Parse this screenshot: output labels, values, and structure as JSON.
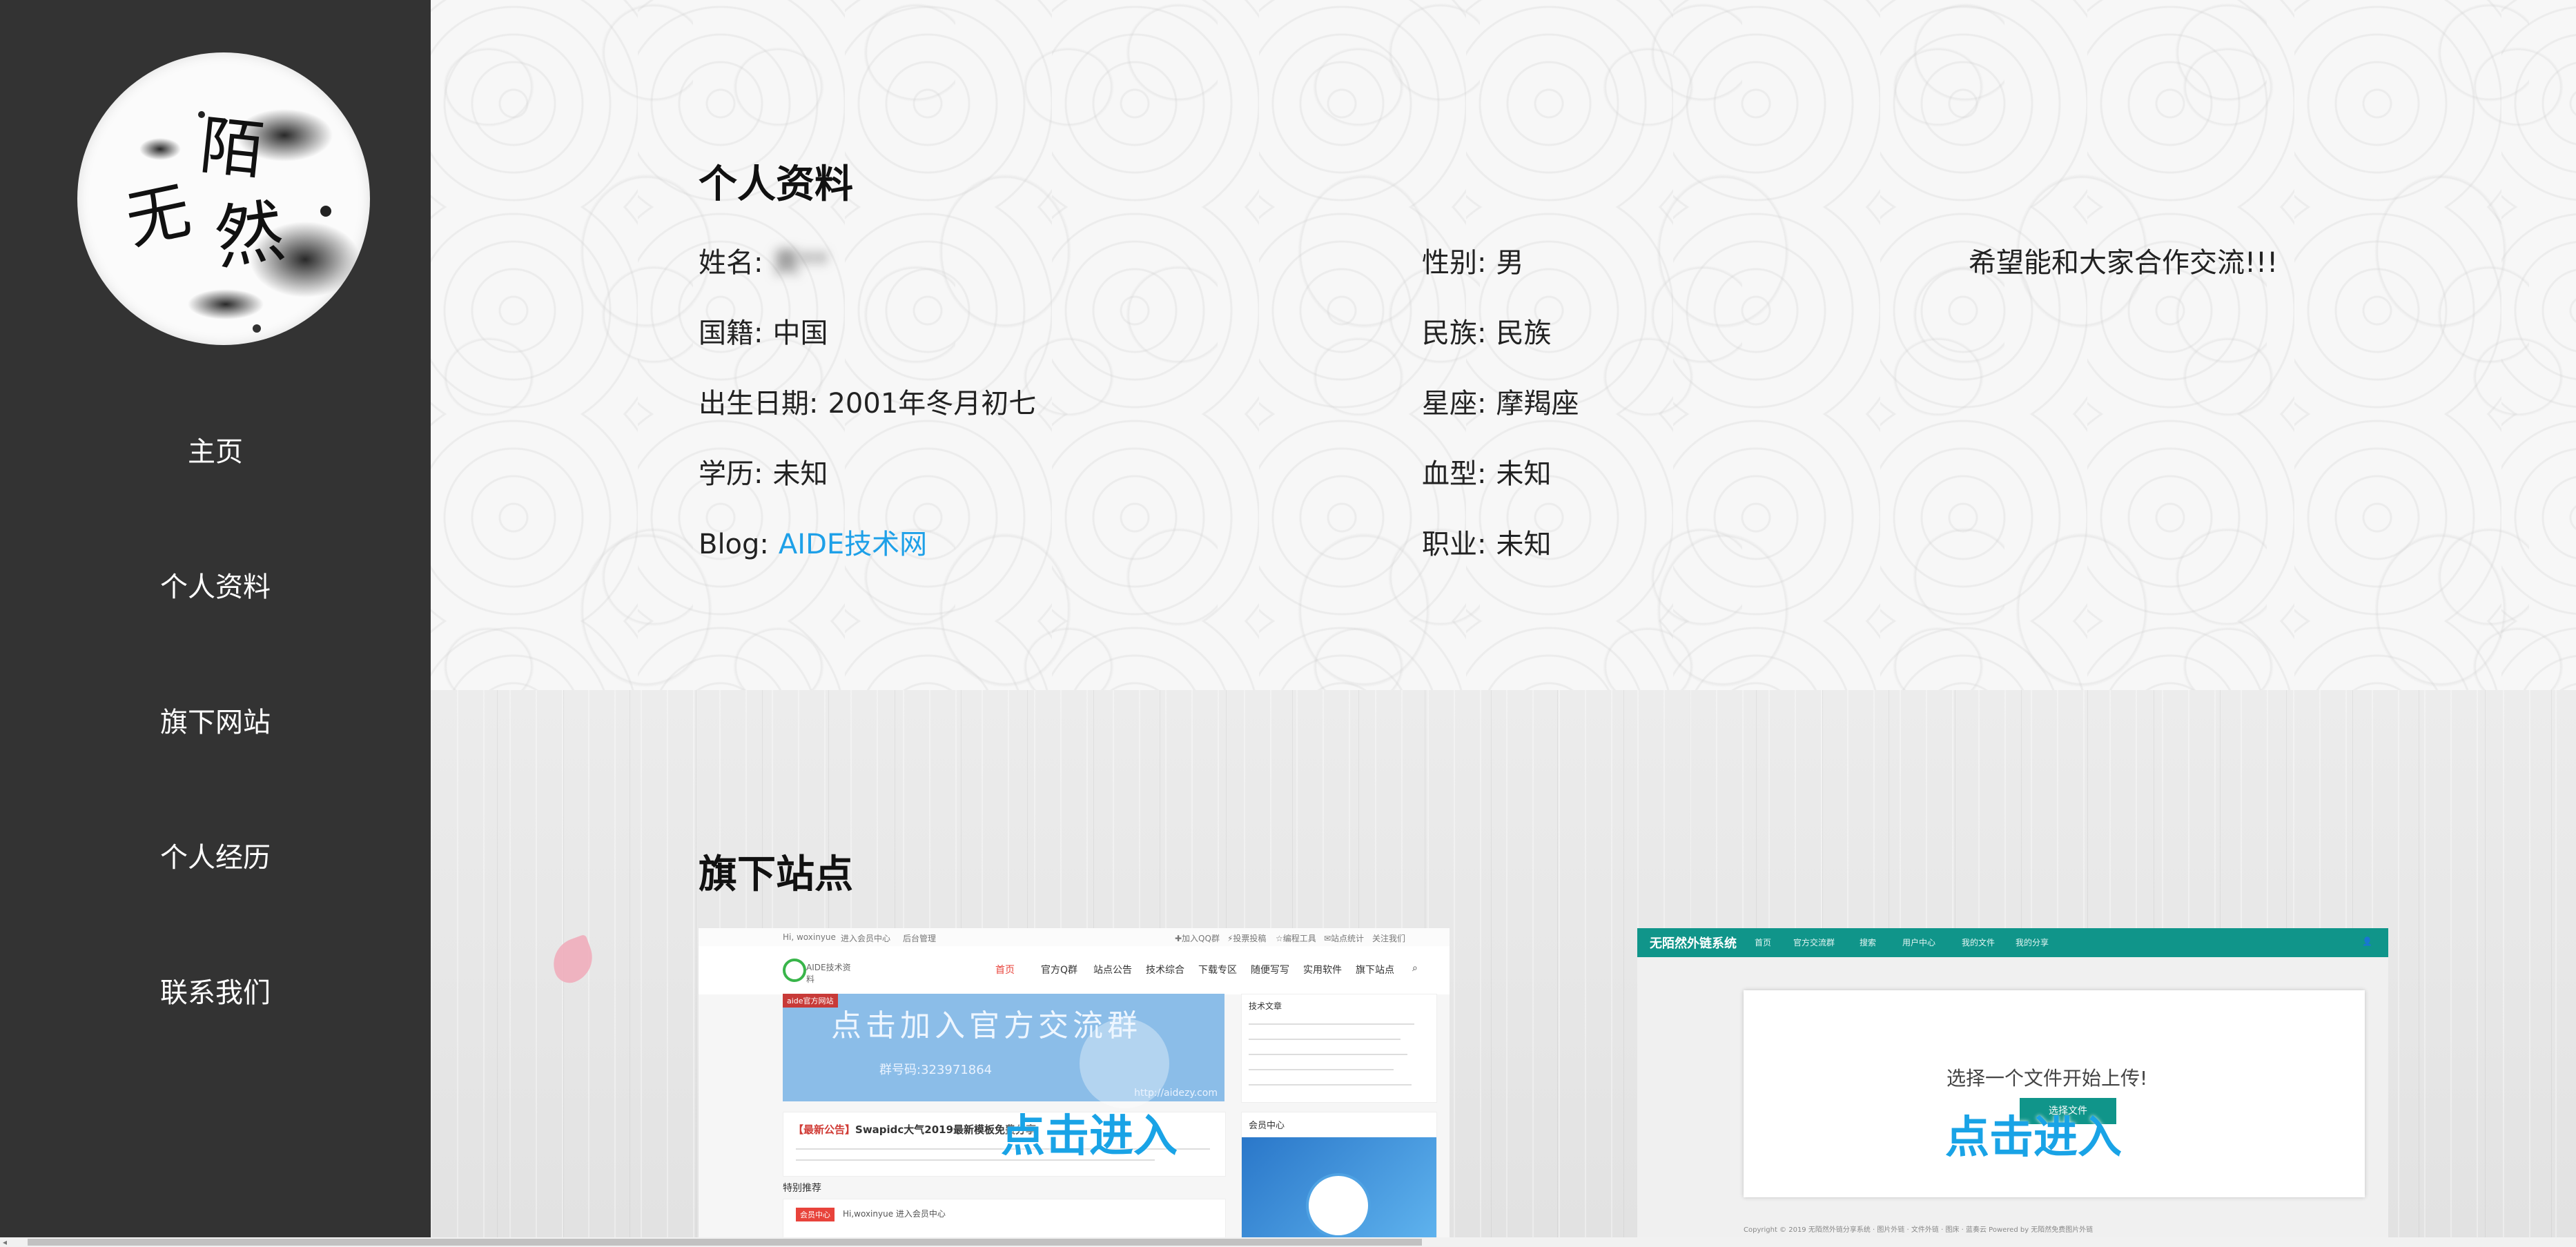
{
  "sidebar": {
    "nav": [
      {
        "label": "主页"
      },
      {
        "label": "个人资料"
      },
      {
        "label": "旗下网站"
      },
      {
        "label": "个人经历"
      },
      {
        "label": "联系我们"
      }
    ],
    "logo_text": "无陌然"
  },
  "profile": {
    "title": "个人资料",
    "fields": {
      "name": {
        "label": "姓名:",
        "value": "黄**"
      },
      "gender": {
        "label": "性别:",
        "value": "男"
      },
      "nationality": {
        "label": "国籍:",
        "value": "中国"
      },
      "ethnicity": {
        "label": "民族:",
        "value": "民族"
      },
      "birthday": {
        "label": "出生日期:",
        "value": "2001年冬月初七"
      },
      "zodiac": {
        "label": "星座:",
        "value": "摩羯座"
      },
      "education": {
        "label": "学历:",
        "value": "未知"
      },
      "blood": {
        "label": "血型:",
        "value": "未知"
      },
      "blog": {
        "label": "Blog:",
        "value": "AIDE技术网"
      },
      "job": {
        "label": "职业:",
        "value": "未知"
      }
    },
    "message": "希望能和大家合作交流!!!"
  },
  "sites": {
    "title": "旗下站点",
    "cards": [
      {
        "enter_label": "点击进入",
        "topbar": [
          "Hi, woxinyue",
          "进入会员中心",
          "后台管理",
          "✚加入QQ群",
          "⚡投票投稿",
          "☆编程工具",
          "✉站点统计",
          "关注我们"
        ],
        "logo": "AIDE技术资料",
        "nav": [
          "首页",
          "官方Q群",
          "站点公告",
          "技术综合",
          "下载专区",
          "随便写写",
          "实用软件",
          "旗下站点"
        ],
        "banner_tag": "aide官方网站",
        "banner_title": "点击加入官方交流群",
        "banner_qq": "群号码:323971864",
        "banner_url": "http://aidezy.com",
        "side_title": "技术文章",
        "news_tag": "【最新公告】",
        "news_title": "Swapidc大气2019最新模板免费分享",
        "member_title": "会员中心",
        "rec_title": "特别推荐",
        "rec_badge": "会员中心",
        "rec_user": "Hi,woxinyue   进入会员中心"
      },
      {
        "enter_label": "点击进入",
        "brand": "无陌然外链系统",
        "nav": [
          "首页",
          "官方交流群",
          "搜索",
          "用户中心",
          "我的文件",
          "我的分享"
        ],
        "message": "选择一个文件开始上传!",
        "button": "选择文件",
        "footer": "Copyright © 2019 无陌然外链分享系统 · 图片外链 · 文件外链 · 图床 · 蓝奏云 Powered by 无陌然免费图片外链"
      }
    ]
  },
  "colors": {
    "sidebar_bg": "#333333",
    "link": "#1ea0e8",
    "enter": "#19a3e6",
    "card2_brand": "#10958a"
  }
}
